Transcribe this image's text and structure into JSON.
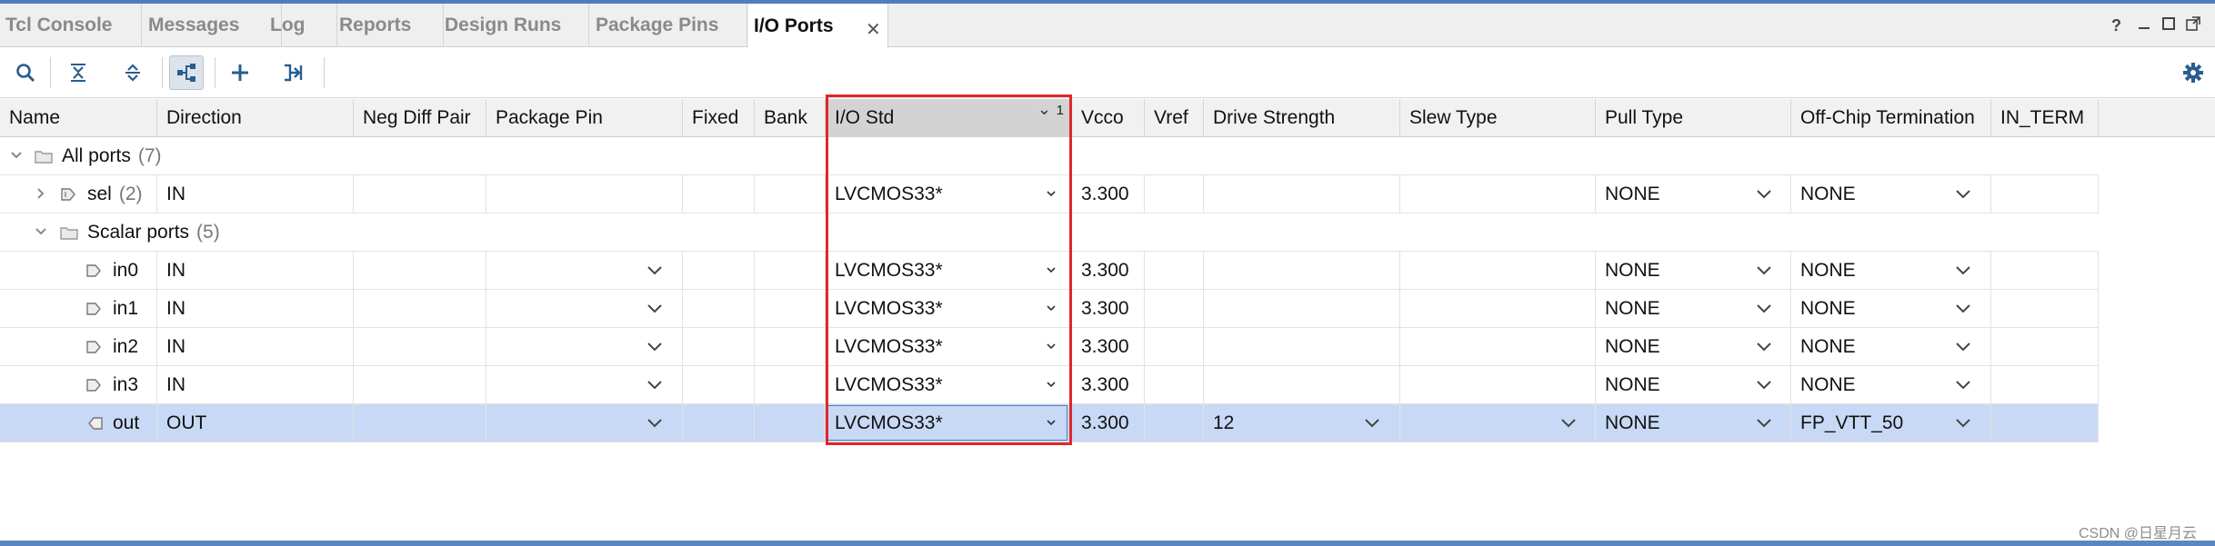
{
  "tabs": [
    {
      "label": "Tcl Console"
    },
    {
      "label": "Messages"
    },
    {
      "label": "Log"
    },
    {
      "label": "Reports"
    },
    {
      "label": "Design Runs"
    },
    {
      "label": "Package Pins"
    },
    {
      "label": "I/O Ports",
      "active": true
    }
  ],
  "window_controls": {
    "help": "?"
  },
  "columns": [
    "Name",
    "Direction",
    "Neg Diff Pair",
    "Package Pin",
    "Fixed",
    "Bank",
    "I/O Std",
    "Vcco",
    "Vref",
    "Drive Strength",
    "Slew Type",
    "Pull Type",
    "Off-Chip Termination",
    "IN_TERM"
  ],
  "sort": {
    "column": "I/O Std",
    "index": "1"
  },
  "tree": {
    "all_ports": {
      "label": "All ports",
      "count": "(7)"
    },
    "sel": {
      "label": "sel",
      "count": "(2)",
      "direction": "IN",
      "io_std": "LVCMOS33*",
      "vcco": "3.300",
      "pull_type": "NONE",
      "termination": "NONE"
    },
    "scalar_ports": {
      "label": "Scalar ports",
      "count": "(5)"
    }
  },
  "ports": [
    {
      "name": "in0",
      "direction": "IN",
      "io_std": "LVCMOS33*",
      "vcco": "3.300",
      "drive_strength": "",
      "pull_type": "NONE",
      "termination": "NONE"
    },
    {
      "name": "in1",
      "direction": "IN",
      "io_std": "LVCMOS33*",
      "vcco": "3.300",
      "drive_strength": "",
      "pull_type": "NONE",
      "termination": "NONE"
    },
    {
      "name": "in2",
      "direction": "IN",
      "io_std": "LVCMOS33*",
      "vcco": "3.300",
      "drive_strength": "",
      "pull_type": "NONE",
      "termination": "NONE"
    },
    {
      "name": "in3",
      "direction": "IN",
      "io_std": "LVCMOS33*",
      "vcco": "3.300",
      "drive_strength": "",
      "pull_type": "NONE",
      "termination": "NONE"
    },
    {
      "name": "out",
      "direction": "OUT",
      "io_std": "LVCMOS33*",
      "vcco": "3.300",
      "drive_strength": "12",
      "pull_type": "NONE",
      "termination": "FP_VTT_50"
    }
  ],
  "watermark": "CSDN @日星月云",
  "colors": {
    "accent": "#4d7fbf",
    "selection": "#c8d9f5",
    "highlight": "#e0272b",
    "icon": "#2a5d8f"
  }
}
